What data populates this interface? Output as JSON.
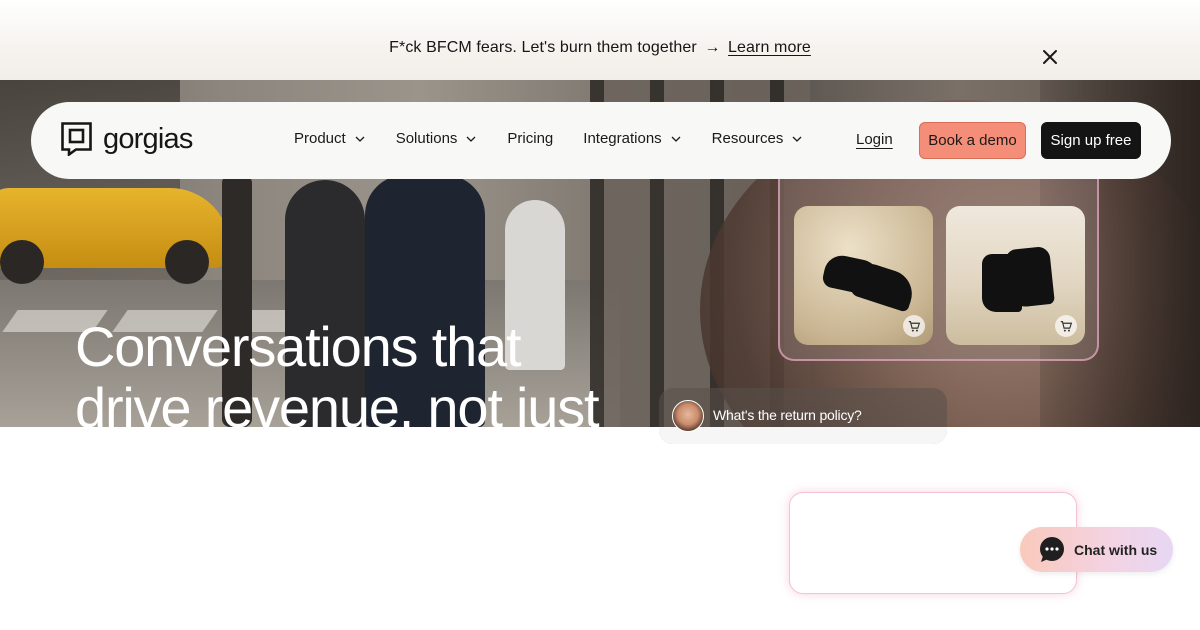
{
  "announcement": {
    "text": "F*ck BFCM fears. Let's burn them together",
    "arrow": "→",
    "link_label": "Learn more",
    "close_icon": "close-icon"
  },
  "nav": {
    "logo_text": "gorgias",
    "items": [
      {
        "label": "Product",
        "has_dropdown": true
      },
      {
        "label": "Solutions",
        "has_dropdown": true
      },
      {
        "label": "Pricing",
        "has_dropdown": false
      },
      {
        "label": "Integrations",
        "has_dropdown": true
      },
      {
        "label": "Resources",
        "has_dropdown": true
      }
    ],
    "login_label": "Login",
    "demo_label": "Book a demo",
    "signup_label": "Sign up free"
  },
  "hero": {
    "headline_line1": "Conversations that",
    "headline_line2": "drive revenue, not just"
  },
  "chat_demo": {
    "question": "What's the return policy?"
  },
  "chat_widget": {
    "label": "Chat with us",
    "icon": "chat-bubble-icon"
  },
  "colors": {
    "demo_button": "#f48e78",
    "signup_button": "#141414",
    "nav_background": "#f8f8f7"
  }
}
